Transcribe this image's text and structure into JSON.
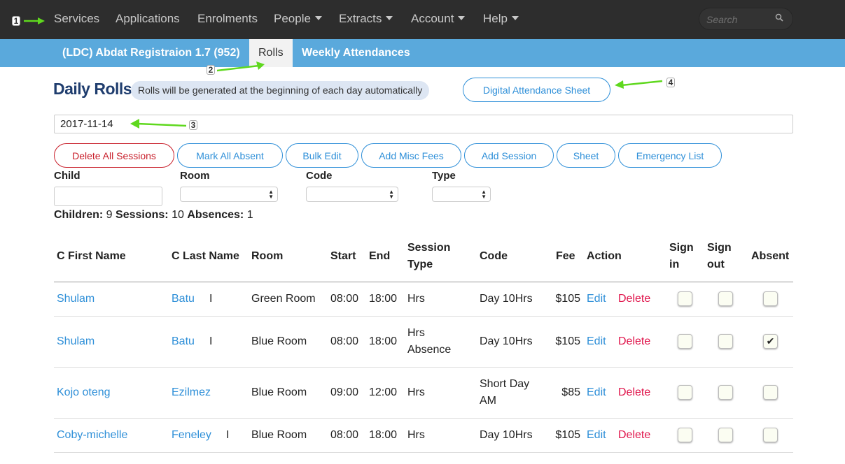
{
  "topnav": {
    "items": [
      {
        "label": "Services",
        "dropdown": false
      },
      {
        "label": "Applications",
        "dropdown": false
      },
      {
        "label": "Enrolments",
        "dropdown": false
      },
      {
        "label": "People",
        "dropdown": true
      },
      {
        "label": "Extracts",
        "dropdown": true
      },
      {
        "label": "Account",
        "dropdown": true
      },
      {
        "label": "Help",
        "dropdown": true
      }
    ],
    "search_placeholder": "Search"
  },
  "subnav": {
    "service": "(LDC) Abdat Registraion 1.7 (952)",
    "tabs": [
      {
        "label": "Rolls",
        "active": true
      },
      {
        "label": "Weekly Attendances",
        "active": false
      }
    ]
  },
  "header": {
    "title": "Daily Rolls",
    "info": "Rolls will be generated at the beginning of each day automatically",
    "digital_sheet_button": "Digital Attendance Sheet"
  },
  "date_value": "2017-11-14",
  "actions": [
    "Delete All Sessions",
    "Mark All Absent",
    "Bulk Edit",
    "Add Misc Fees",
    "Add Session",
    "Sheet",
    "Emergency List"
  ],
  "filters": {
    "child_label": "Child",
    "room_label": "Room",
    "code_label": "Code",
    "type_label": "Type",
    "child_value": "",
    "room_value": "",
    "code_value": "",
    "type_value": ""
  },
  "summary": {
    "children_label": "Children:",
    "children": "9",
    "sessions_label": "Sessions:",
    "sessions": "10",
    "absences_label": "Absences:",
    "absences": "1"
  },
  "table": {
    "headers": {
      "first_name": "C First Name",
      "last_name": "C Last Name",
      "room": "Room",
      "start": "Start",
      "end": "End",
      "session_type_1": "Session",
      "session_type_2": "Type",
      "code": "Code",
      "fee": "Fee",
      "action": "Action",
      "sign_in_1": "Sign",
      "sign_in_2": "in",
      "sign_out_1": "Sign",
      "sign_out_2": "out",
      "absent": "Absent"
    },
    "edit_label": "Edit",
    "delete_label": "Delete",
    "rows": [
      {
        "first": "Shulam",
        "last": "Batu",
        "flag": "I",
        "room": "Green Room",
        "start": "08:00",
        "end": "18:00",
        "type1": "Hrs",
        "type2": "",
        "code1": "Day 10Hrs",
        "code2": "",
        "fee": "$105",
        "sign_in": false,
        "sign_out": false,
        "absent": false
      },
      {
        "first": "Shulam",
        "last": "Batu",
        "flag": "I",
        "room": "Blue Room",
        "start": "08:00",
        "end": "18:00",
        "type1": "Hrs",
        "type2": "Absence",
        "code1": "Day 10Hrs",
        "code2": "",
        "fee": "$105",
        "sign_in": false,
        "sign_out": false,
        "absent": true
      },
      {
        "first": "Kojo oteng",
        "last": "Ezilmez",
        "flag": "",
        "room": "Blue Room",
        "start": "09:00",
        "end": "12:00",
        "type1": "Hrs",
        "type2": "",
        "code1": "Short Day",
        "code2": "AM",
        "fee": "$85",
        "sign_in": false,
        "sign_out": false,
        "absent": false
      },
      {
        "first": "Coby-michelle",
        "last": "Feneley",
        "flag": "I",
        "room": "Blue Room",
        "start": "08:00",
        "end": "18:00",
        "type1": "Hrs",
        "type2": "",
        "code1": "Day 10Hrs",
        "code2": "",
        "fee": "$105",
        "sign_in": false,
        "sign_out": false,
        "absent": false
      }
    ]
  },
  "annotations": [
    "1",
    "2",
    "3",
    "4"
  ],
  "colors": {
    "topnav_bg": "#2d2d2d",
    "subnav_bg": "#5aa9dc",
    "link": "#2e8fd8",
    "danger": "#c81e2a",
    "delete_link": "#e0134a",
    "title": "#1f3d6e",
    "annotation_arrow": "#5fd81e"
  }
}
